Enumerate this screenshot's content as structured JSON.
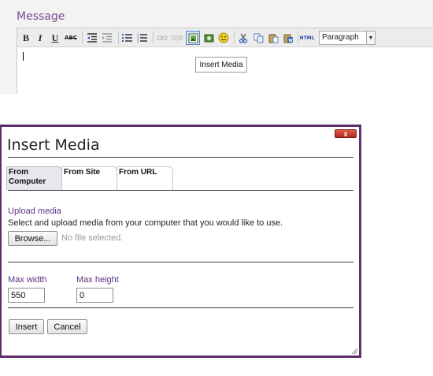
{
  "editor": {
    "label": "Message",
    "toolbar": {
      "bold": "B",
      "italic": "I",
      "underline": "U",
      "strike": "ABC",
      "html": "HTML",
      "format_value": "Paragraph"
    },
    "tooltip": "Insert Media"
  },
  "dialog": {
    "title": "Insert Media",
    "close": "x",
    "tabs": [
      {
        "label": "From Computer"
      },
      {
        "label": "From Site"
      },
      {
        "label": "From URL"
      }
    ],
    "upload": {
      "heading": "Upload media",
      "description": "Select and upload media from your computer that you would like to use.",
      "browse": "Browse...",
      "file_status": "No file selected."
    },
    "max_width": {
      "label": "Max width",
      "value": "550"
    },
    "max_height": {
      "label": "Max height",
      "value": "0"
    },
    "insert": "Insert",
    "cancel": "Cancel"
  },
  "colors": {
    "accent_purple": "#5c2f80",
    "dialog_border": "#5d2d6e",
    "close_red": "#c0392b"
  }
}
